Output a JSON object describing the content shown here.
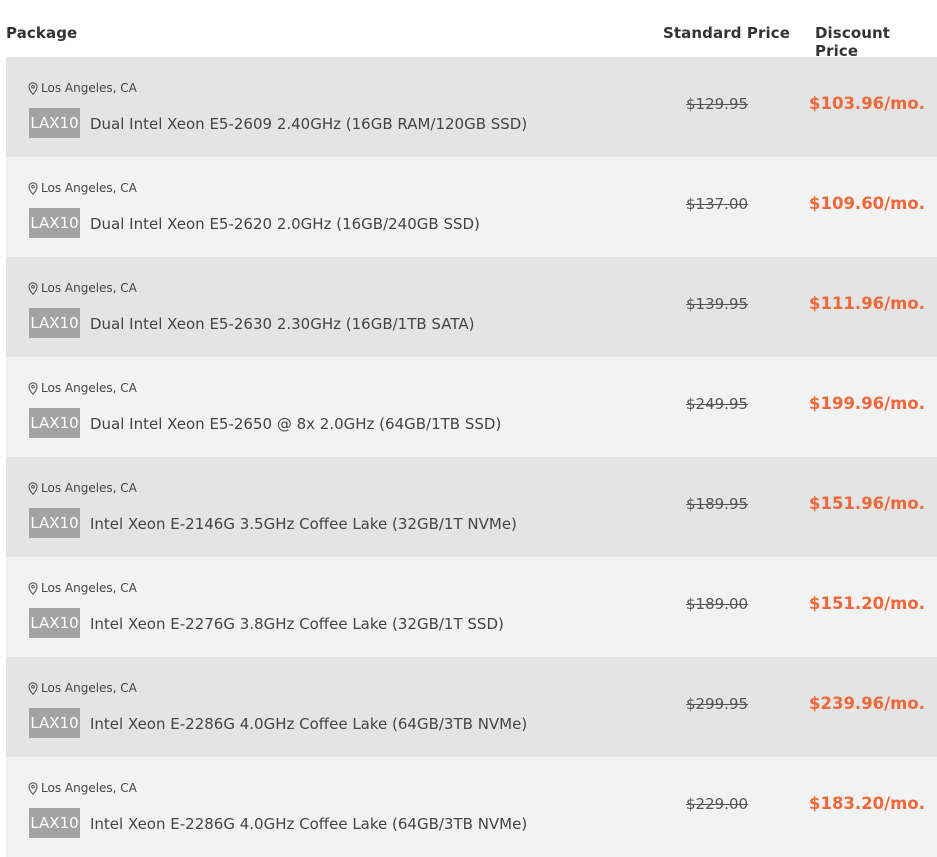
{
  "headers": {
    "package": "Package",
    "standard_price": "Standard Price",
    "discount_price": "Discount Price"
  },
  "colors": {
    "discount": "#f0683a",
    "badge_bg": "#a3a3a3",
    "row_dark": "#e4e4e4",
    "row_light": "#f2f2f2"
  },
  "location_icon": "map-pin-icon",
  "rows": [
    {
      "location": "Los Angeles, CA",
      "badge": "LAX10",
      "name": "Dual Intel Xeon E5-2609 2.40GHz (16GB RAM/120GB SSD)",
      "standard": "$129.95",
      "discount": "$103.96/mo."
    },
    {
      "location": "Los Angeles, CA",
      "badge": "LAX10",
      "name": "Dual Intel Xeon E5-2620 2.0GHz (16GB/240GB SSD)",
      "standard": "$137.00",
      "discount": "$109.60/mo."
    },
    {
      "location": "Los Angeles, CA",
      "badge": "LAX10",
      "name": "Dual Intel Xeon E5-2630 2.30GHz (16GB/1TB SATA)",
      "standard": "$139.95",
      "discount": "$111.96/mo."
    },
    {
      "location": "Los Angeles, CA",
      "badge": "LAX10",
      "name": "Dual Intel Xeon E5-2650 @ 8x 2.0GHz (64GB/1TB SSD)",
      "standard": "$249.95",
      "discount": "$199.96/mo."
    },
    {
      "location": "Los Angeles, CA",
      "badge": "LAX10",
      "name": "Intel Xeon E-2146G 3.5GHz Coffee Lake (32GB/1T NVMe)",
      "standard": "$189.95",
      "discount": "$151.96/mo."
    },
    {
      "location": "Los Angeles, CA",
      "badge": "LAX10",
      "name": "Intel Xeon E-2276G 3.8GHz Coffee Lake (32GB/1T SSD)",
      "standard": "$189.00",
      "discount": "$151.20/mo."
    },
    {
      "location": "Los Angeles, CA",
      "badge": "LAX10",
      "name": "Intel Xeon E-2286G 4.0GHz Coffee Lake (64GB/3TB NVMe)",
      "standard": "$299.95",
      "discount": "$239.96/mo."
    },
    {
      "location": "Los Angeles, CA",
      "badge": "LAX10",
      "name": "Intel Xeon E-2286G 4.0GHz Coffee Lake (64GB/3TB NVMe)",
      "standard": "$229.00",
      "discount": "$183.20/mo."
    }
  ]
}
